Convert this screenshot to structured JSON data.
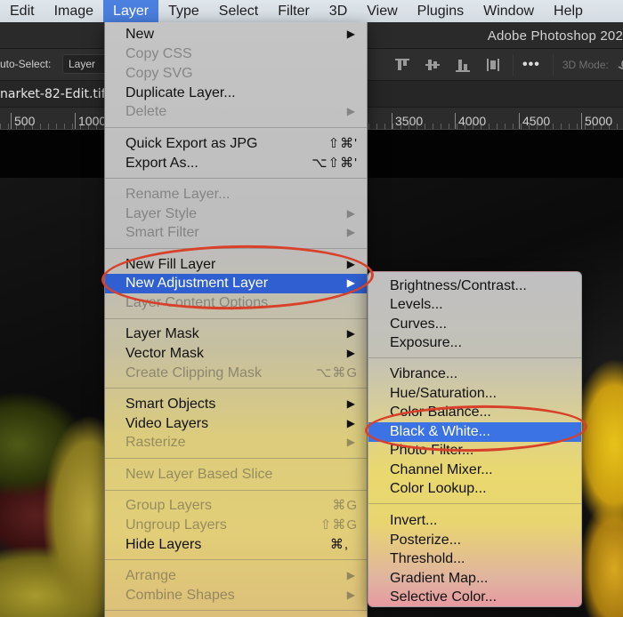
{
  "menubar": {
    "items": [
      {
        "label": "Edit"
      },
      {
        "label": "Image"
      },
      {
        "label": "Layer",
        "active": true
      },
      {
        "label": "Type"
      },
      {
        "label": "Select"
      },
      {
        "label": "Filter"
      },
      {
        "label": "3D"
      },
      {
        "label": "View"
      },
      {
        "label": "Plugins"
      },
      {
        "label": "Window"
      },
      {
        "label": "Help"
      }
    ]
  },
  "app": {
    "title": "Adobe Photoshop 202",
    "options_bar": {
      "auto_select_label": "uto-Select:",
      "auto_select_value": "Layer",
      "more_label": "•••",
      "mode_3d_label": "3D Mode:"
    },
    "document_tab": "narket-82-Edit.tif",
    "ruler_labels": [
      "500",
      "1000",
      "3500",
      "4000",
      "4500",
      "5000"
    ]
  },
  "layer_menu": {
    "items": [
      {
        "label": "New",
        "enabled": true,
        "submenu": true
      },
      {
        "label": "Copy CSS",
        "enabled": false
      },
      {
        "label": "Copy SVG",
        "enabled": false
      },
      {
        "label": "Duplicate Layer...",
        "enabled": true
      },
      {
        "label": "Delete",
        "enabled": false,
        "submenu": true
      },
      {
        "label": "Quick Export as JPG",
        "enabled": true,
        "shortcut": "⇧⌘'"
      },
      {
        "label": "Export As...",
        "enabled": true,
        "shortcut": "⌥⇧⌘'"
      },
      {
        "label": "Rename Layer...",
        "enabled": false
      },
      {
        "label": "Layer Style",
        "enabled": false,
        "submenu": true
      },
      {
        "label": "Smart Filter",
        "enabled": false,
        "submenu": true
      },
      {
        "label": "New Fill Layer",
        "enabled": true,
        "submenu": true
      },
      {
        "label": "New Adjustment Layer",
        "enabled": true,
        "submenu": true,
        "highlighted": true
      },
      {
        "label": "Layer Content Options...",
        "enabled": false
      },
      {
        "label": "Layer Mask",
        "enabled": true,
        "submenu": true
      },
      {
        "label": "Vector Mask",
        "enabled": true,
        "submenu": true
      },
      {
        "label": "Create Clipping Mask",
        "enabled": false,
        "shortcut": "⌥⌘G"
      },
      {
        "label": "Smart Objects",
        "enabled": true,
        "submenu": true
      },
      {
        "label": "Video Layers",
        "enabled": true,
        "submenu": true
      },
      {
        "label": "Rasterize",
        "enabled": false,
        "submenu": true
      },
      {
        "label": "New Layer Based Slice",
        "enabled": false
      },
      {
        "label": "Group Layers",
        "enabled": false,
        "shortcut": "⌘G"
      },
      {
        "label": "Ungroup Layers",
        "enabled": false,
        "shortcut": "⇧⌘G"
      },
      {
        "label": "Hide Layers",
        "enabled": true,
        "shortcut": "⌘,"
      },
      {
        "label": "Arrange",
        "enabled": false,
        "submenu": true
      },
      {
        "label": "Combine Shapes",
        "enabled": false,
        "submenu": true
      }
    ]
  },
  "adjustment_submenu": {
    "items": [
      {
        "label": "Brightness/Contrast..."
      },
      {
        "label": "Levels..."
      },
      {
        "label": "Curves..."
      },
      {
        "label": "Exposure..."
      },
      {
        "label": "Vibrance..."
      },
      {
        "label": "Hue/Saturation..."
      },
      {
        "label": "Color Balance..."
      },
      {
        "label": "Black & White...",
        "highlighted": true
      },
      {
        "label": "Photo Filter..."
      },
      {
        "label": "Channel Mixer..."
      },
      {
        "label": "Color Lookup..."
      },
      {
        "label": "Invert..."
      },
      {
        "label": "Posterize..."
      },
      {
        "label": "Threshold..."
      },
      {
        "label": "Gradient Map..."
      },
      {
        "label": "Selective Color..."
      }
    ]
  },
  "colors": {
    "menu_highlight": "#2f5fd0",
    "submenu_highlight": "#3b73e4",
    "menubar_active": "#4b7fe0",
    "annotation": "#d8402a"
  }
}
